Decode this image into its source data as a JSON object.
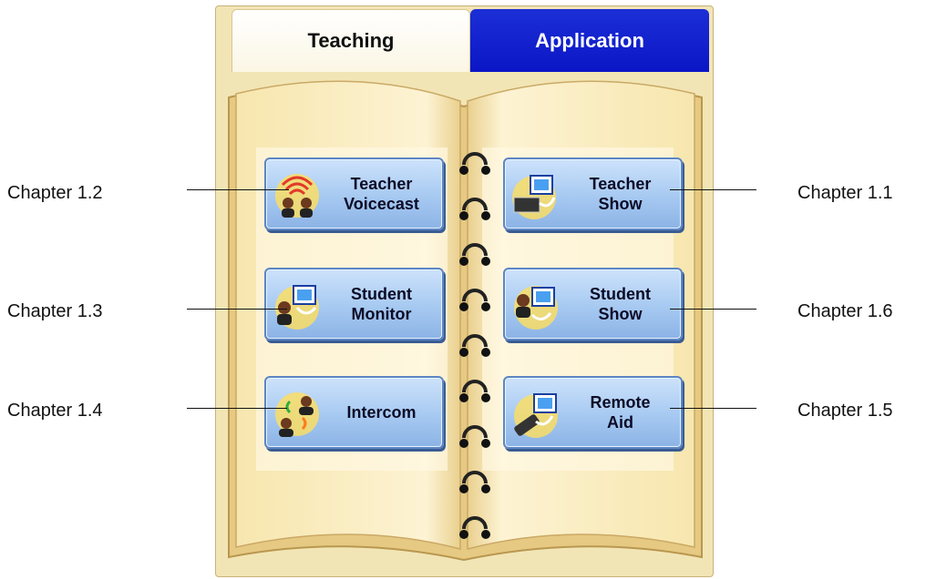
{
  "tabs": [
    {
      "label": "Teaching",
      "active": true
    },
    {
      "label": "Application",
      "active": false
    }
  ],
  "buttons": {
    "teacher_voicecast": {
      "label": "Teacher\nVoicecast",
      "icon": "voicecast-icon"
    },
    "teacher_show": {
      "label": "Teacher\nShow",
      "icon": "teacher-show-icon"
    },
    "student_monitor": {
      "label": "Student\nMonitor",
      "icon": "student-monitor-icon"
    },
    "student_show": {
      "label": "Student\nShow",
      "icon": "student-show-icon"
    },
    "intercom": {
      "label": "Intercom",
      "icon": "intercom-icon"
    },
    "remote_aid": {
      "label": "Remote\nAid",
      "icon": "remote-aid-icon"
    }
  },
  "annotations": {
    "c12": "Chapter 1.2",
    "c13": "Chapter 1.3",
    "c14": "Chapter 1.4",
    "c11": "Chapter 1.1",
    "c16": "Chapter 1.6",
    "c15": "Chapter 1.5"
  },
  "colors": {
    "tab_active_bg": "#ffffff",
    "tab_inactive_bg": "#0a16c6",
    "button_bg": "#a6c9f1",
    "book_page": "#fbefc6"
  }
}
